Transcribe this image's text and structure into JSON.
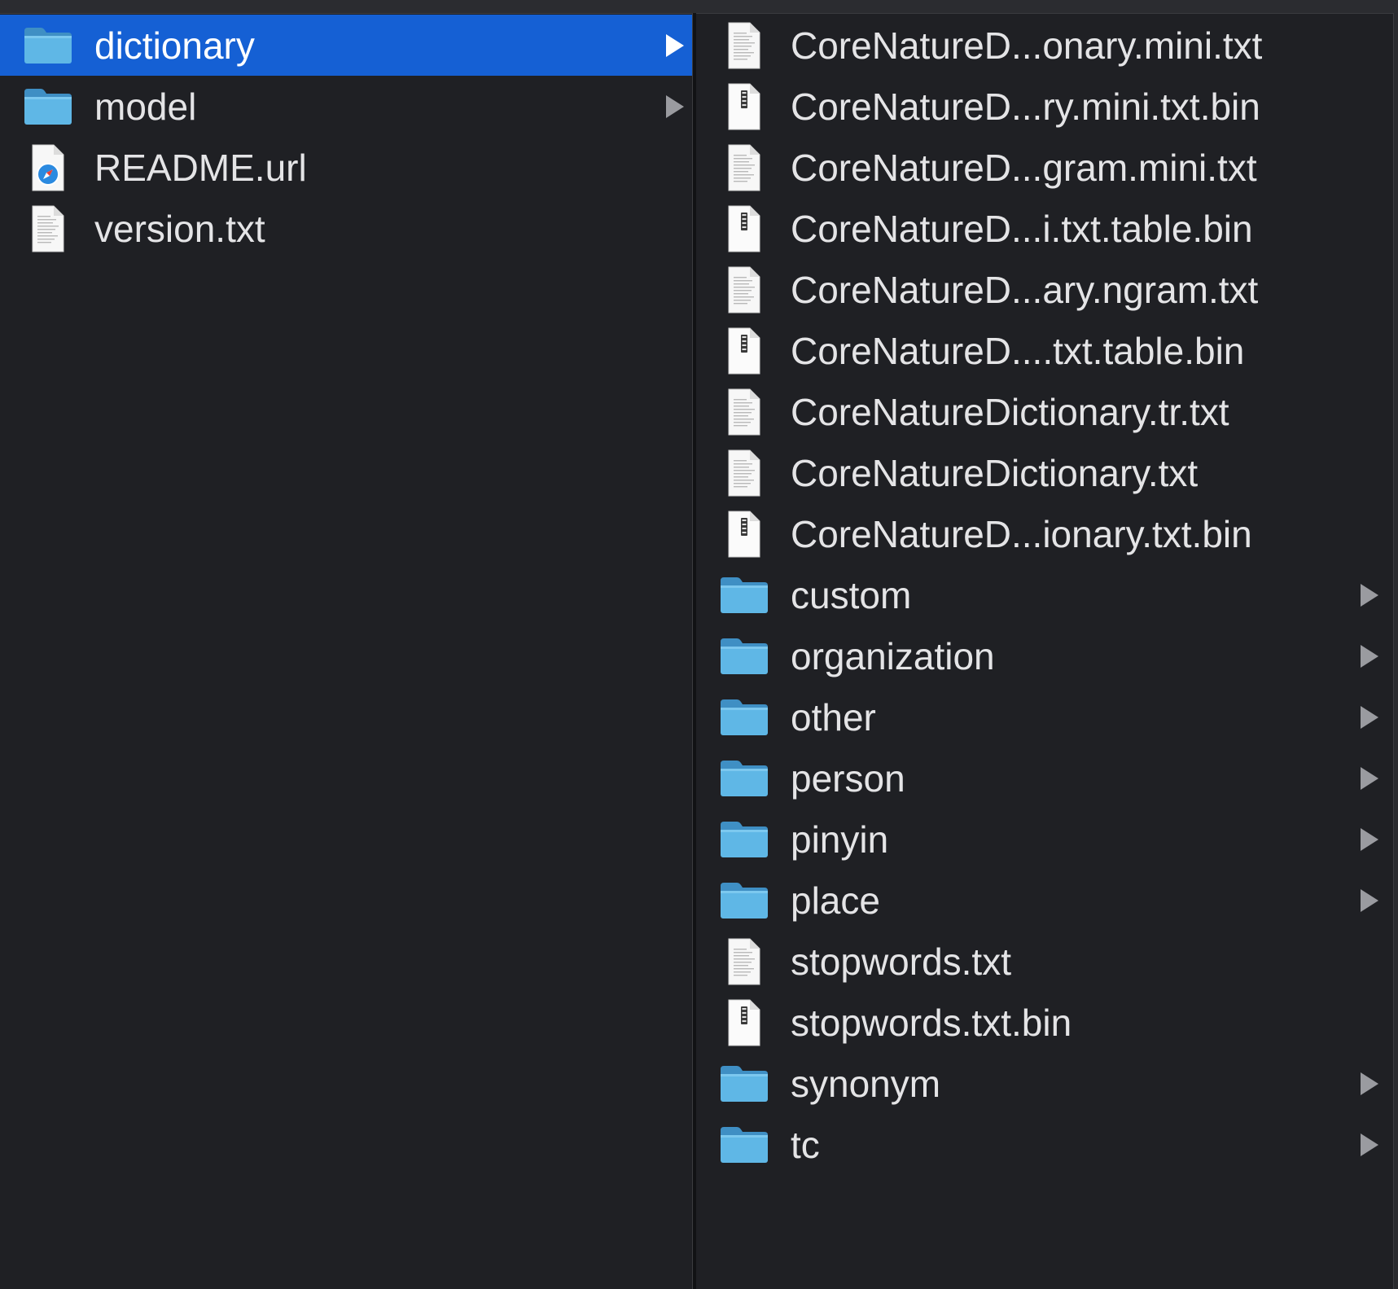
{
  "colors": {
    "background": "#1f2024",
    "selection": "#1560d4",
    "text": "#e4e4e6",
    "folder": "#5fb7e6"
  },
  "column1": {
    "items": [
      {
        "label": "dictionary",
        "type": "folder",
        "icon": "folder-icon",
        "has_children": true,
        "selected": true
      },
      {
        "label": "model",
        "type": "folder",
        "icon": "folder-icon",
        "has_children": true,
        "selected": false
      },
      {
        "label": "README.url",
        "type": "link",
        "icon": "safari-link-icon",
        "has_children": false,
        "selected": false
      },
      {
        "label": "version.txt",
        "type": "text",
        "icon": "text-file-icon",
        "has_children": false,
        "selected": false
      }
    ]
  },
  "column2": {
    "items": [
      {
        "label": "CoreNatureD...onary.mini.txt",
        "type": "text",
        "icon": "text-file-icon",
        "has_children": false
      },
      {
        "label": "CoreNatureD...ry.mini.txt.bin",
        "type": "binary",
        "icon": "binary-file-icon",
        "has_children": false
      },
      {
        "label": "CoreNatureD...gram.mini.txt",
        "type": "text",
        "icon": "text-file-icon",
        "has_children": false
      },
      {
        "label": "CoreNatureD...i.txt.table.bin",
        "type": "binary",
        "icon": "binary-file-icon",
        "has_children": false
      },
      {
        "label": "CoreNatureD...ary.ngram.txt",
        "type": "text",
        "icon": "text-file-icon",
        "has_children": false
      },
      {
        "label": "CoreNatureD....txt.table.bin",
        "type": "binary",
        "icon": "binary-file-icon",
        "has_children": false
      },
      {
        "label": "CoreNatureDictionary.tr.txt",
        "type": "text",
        "icon": "text-file-icon",
        "has_children": false
      },
      {
        "label": "CoreNatureDictionary.txt",
        "type": "text",
        "icon": "text-file-icon",
        "has_children": false
      },
      {
        "label": "CoreNatureD...ionary.txt.bin",
        "type": "binary",
        "icon": "binary-file-icon",
        "has_children": false
      },
      {
        "label": "custom",
        "type": "folder",
        "icon": "folder-icon",
        "has_children": true
      },
      {
        "label": "organization",
        "type": "folder",
        "icon": "folder-icon",
        "has_children": true
      },
      {
        "label": "other",
        "type": "folder",
        "icon": "folder-icon",
        "has_children": true
      },
      {
        "label": "person",
        "type": "folder",
        "icon": "folder-icon",
        "has_children": true
      },
      {
        "label": "pinyin",
        "type": "folder",
        "icon": "folder-icon",
        "has_children": true
      },
      {
        "label": "place",
        "type": "folder",
        "icon": "folder-icon",
        "has_children": true
      },
      {
        "label": "stopwords.txt",
        "type": "text",
        "icon": "text-file-icon",
        "has_children": false
      },
      {
        "label": "stopwords.txt.bin",
        "type": "binary",
        "icon": "binary-file-icon",
        "has_children": false
      },
      {
        "label": "synonym",
        "type": "folder",
        "icon": "folder-icon",
        "has_children": true
      },
      {
        "label": "tc",
        "type": "folder",
        "icon": "folder-icon",
        "has_children": true
      }
    ]
  }
}
